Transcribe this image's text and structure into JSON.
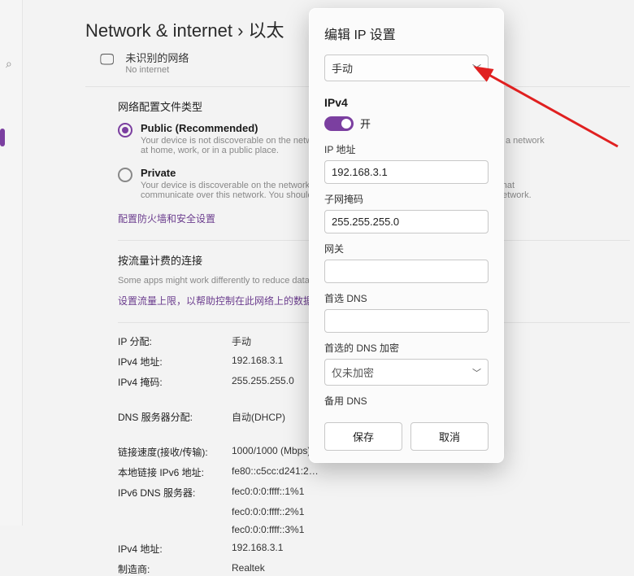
{
  "breadcrumb": "Network & internet  ›  以太",
  "left": {
    "search": "⌕"
  },
  "netRow": {
    "title": "未识别的网络",
    "sub": "No internet"
  },
  "profileSection": {
    "title": "网络配置文件类型",
    "public": {
      "label": "Public (Recommended)",
      "desc": "Your device is not discoverable on the network. Use this in most cases—when connected to a network at home, work, or in a public place."
    },
    "private": {
      "label": "Private",
      "desc": "Your device is discoverable on the network. Select this if you need file sharing or use apps that communicate over this network. You should know and trust the people and devices on the network."
    },
    "firewallLink": "配置防火墙和安全设置"
  },
  "meteredSection": {
    "title": "按流量计费的连接",
    "sub": "Some apps might work differently to reduce data usage when you're connected to this network.",
    "link": "设置流量上限，以帮助控制在此网络上的数据使用量"
  },
  "info": {
    "rows": [
      {
        "k": "IP 分配:",
        "v": "手动"
      },
      {
        "k": "IPv4 地址:",
        "v": "192.168.3.1"
      },
      {
        "k": "IPv4 掩码:",
        "v": "255.255.255.0"
      }
    ],
    "dns": {
      "k": "DNS 服务器分配:",
      "v": "自动(DHCP)"
    },
    "rows2": [
      {
        "k": "链接速度(接收/传输):",
        "v": "1000/1000 (Mbps)"
      },
      {
        "k": "本地链接 IPv6 地址:",
        "v": "fe80::c5cc:d241:2…"
      },
      {
        "k": "IPv6 DNS 服务器:",
        "v": "fec0:0:0:ffff::1%1"
      },
      {
        "k": "",
        "v": "fec0:0:0:ffff::2%1"
      },
      {
        "k": "",
        "v": "fec0:0:0:ffff::3%1"
      },
      {
        "k": "IPv4 地址:",
        "v": "192.168.3.1"
      },
      {
        "k": "制造商:",
        "v": "Realtek"
      }
    ]
  },
  "dialog": {
    "title": "编辑 IP 设置",
    "modeSelected": "手动",
    "ipv4Label": "IPv4",
    "toggleOn": "开",
    "fields": {
      "ipLabel": "IP 地址",
      "ipValue": "192.168.3.1",
      "maskLabel": "子网掩码",
      "maskValue": "255.255.255.0",
      "gatewayLabel": "网关",
      "gatewayValue": "",
      "dns1Label": "首选 DNS",
      "dns1Value": "",
      "dnsEncLabel": "首选的 DNS 加密",
      "dnsEncValue": "仅未加密",
      "dns2Label": "备用 DNS"
    },
    "saveBtn": "保存",
    "cancelBtn": "取消"
  }
}
